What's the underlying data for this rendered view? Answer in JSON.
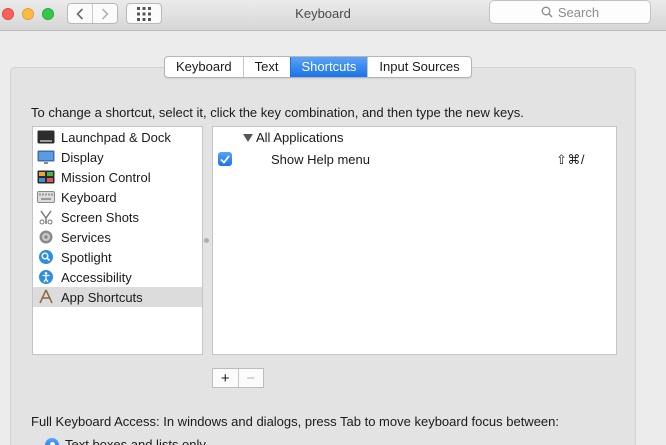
{
  "window": {
    "title": "Keyboard",
    "search_placeholder": "Search"
  },
  "tabs": [
    {
      "label": "Keyboard",
      "active": false
    },
    {
      "label": "Text",
      "active": false
    },
    {
      "label": "Shortcuts",
      "active": true
    },
    {
      "label": "Input Sources",
      "active": false
    }
  ],
  "instruction": "To change a shortcut, select it, click the key combination, and then type the new keys.",
  "categories": [
    {
      "label": "Launchpad & Dock",
      "icon": "launchpad-dock-icon"
    },
    {
      "label": "Display",
      "icon": "display-icon"
    },
    {
      "label": "Mission Control",
      "icon": "mission-control-icon"
    },
    {
      "label": "Keyboard",
      "icon": "keyboard-icon"
    },
    {
      "label": "Screen Shots",
      "icon": "screenshot-icon"
    },
    {
      "label": "Services",
      "icon": "services-gear-icon"
    },
    {
      "label": "Spotlight",
      "icon": "spotlight-icon"
    },
    {
      "label": "Accessibility",
      "icon": "accessibility-icon"
    },
    {
      "label": "App Shortcuts",
      "icon": "app-shortcuts-icon",
      "selected": true
    }
  ],
  "shortcuts": {
    "group_label": "All Applications",
    "rows": [
      {
        "name": "Show Help menu",
        "keys": "⇧⌘/",
        "checked": true
      }
    ]
  },
  "buttons": {
    "add": "+",
    "remove": "−"
  },
  "full_keyboard_access": {
    "label": "Full Keyboard Access: In windows and dialogs, press Tab to move keyboard focus between:",
    "option_selected": "Text boxes and lists only"
  },
  "colors": {
    "accent": "#1a73e8",
    "selected_row": "#dcdcdc"
  }
}
